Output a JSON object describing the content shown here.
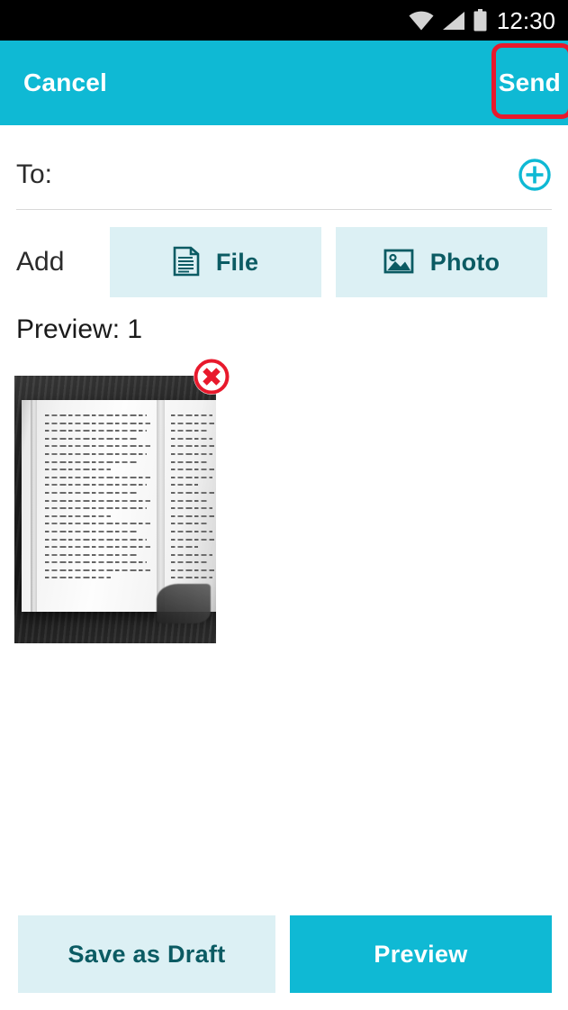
{
  "status_bar": {
    "time": "12:30",
    "icons": [
      "wifi-icon",
      "signal-icon",
      "battery-icon"
    ],
    "background_color": "#000000"
  },
  "app_bar": {
    "cancel_label": "Cancel",
    "send_label": "Send",
    "background_color": "#0FB9D4",
    "highlight_color": "#E8192C",
    "highlighted_element": "send-button"
  },
  "recipient": {
    "label": "To:",
    "value": "",
    "placeholder": "",
    "add_icon": "plus-circle-icon",
    "accent_color": "#0FB9D4"
  },
  "attachments": {
    "label": "Add",
    "buttons": [
      {
        "label": "File",
        "icon": "document-icon"
      },
      {
        "label": "Photo",
        "icon": "image-icon"
      }
    ],
    "button_background": "#DCF0F4",
    "button_text_color": "#0B5B63"
  },
  "preview": {
    "label": "Preview: 1",
    "count": 1,
    "items": [
      {
        "name": "notebook-photo",
        "description": "Grayscale photo of an open handwritten notebook on a dark wooden desk",
        "delete_icon": "close-circle-icon",
        "delete_color": "#E8192C"
      }
    ]
  },
  "bottom_bar": {
    "save_draft_label": "Save as Draft",
    "preview_label": "Preview",
    "save_draft_background": "#DCF0F4",
    "save_draft_text_color": "#0B5B63",
    "preview_background": "#0FB9D4",
    "preview_text_color": "#FFFFFF"
  }
}
